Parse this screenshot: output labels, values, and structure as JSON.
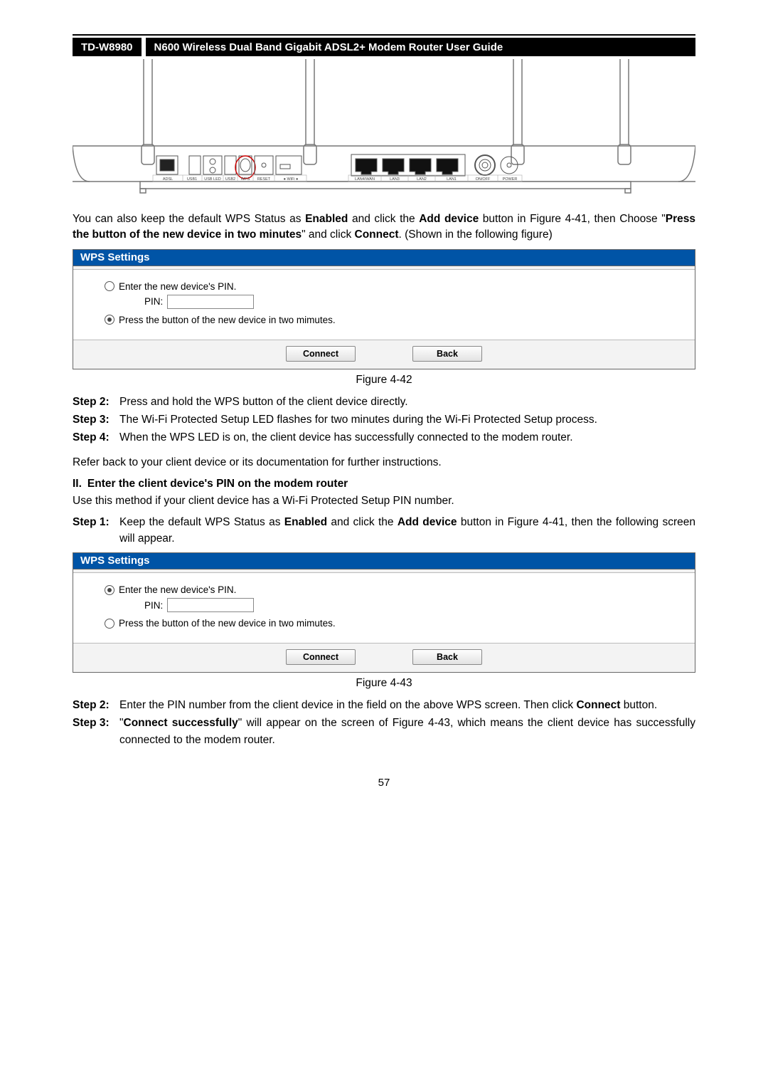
{
  "header": {
    "model": "TD-W8980",
    "title": "N600 Wireless Dual Band Gigabit ADSL2+ Modem Router User Guide"
  },
  "router_labels": {
    "adsl": "ADSL",
    "usb1": "USB1",
    "usbled": "USB LED",
    "usb2": "USB2",
    "wps": "WPS",
    "reset": "RESET",
    "wifi": "● WiFi ●",
    "lan4wan": "LAN4/WAN",
    "lan3": "LAN3",
    "lan2": "LAN2",
    "lan1": "LAN1",
    "onoff": "ON/OFF",
    "power": "POWER"
  },
  "para1_parts": {
    "t1": "You can also keep the default WPS Status as ",
    "b1": "Enabled",
    "t2": " and click the ",
    "b2": "Add device",
    "t3": " button in Figure 4-41, then Choose \"",
    "b3": "Press the button of the new device in two minutes",
    "t4": "\" and click ",
    "b4": "Connect",
    "t5": ". (Shown in the following figure)"
  },
  "wps1": {
    "title": "WPS Settings",
    "opt_pin": "Enter the new device's PIN.",
    "pin_label": "PIN:",
    "opt_button": "Press the button of the new device in two mimutes.",
    "connect": "Connect",
    "back": "Back",
    "selected": "button"
  },
  "fig42": "Figure 4-42",
  "steps_a": {
    "s2_label": "Step 2:",
    "s2": "Press and hold the WPS button of the client device directly.",
    "s3_label": "Step 3:",
    "s3": "The Wi-Fi Protected Setup LED flashes for two minutes during the Wi-Fi Protected Setup process.",
    "s4_label": "Step 4:",
    "s4": "When the WPS LED is on, the client device has successfully connected to the modem router."
  },
  "refer": "Refer back to your client device or its documentation for further instructions.",
  "section2": {
    "num": "II.",
    "title": "Enter the client device's PIN on the modem router"
  },
  "para2": "Use this method if your client device has a Wi-Fi Protected Setup PIN number.",
  "step1b": {
    "label": "Step 1:",
    "t1": "Keep the default WPS Status as ",
    "b1": "Enabled",
    "t2": " and click the ",
    "b2": "Add device",
    "t3": " button in Figure 4-41, then the following screen will appear."
  },
  "wps2": {
    "title": "WPS Settings",
    "opt_pin": "Enter the new device's PIN.",
    "pin_label": "PIN:",
    "opt_button": "Press the button of the new device in two mimutes.",
    "connect": "Connect",
    "back": "Back",
    "selected": "pin"
  },
  "fig43": "Figure 4-43",
  "steps_b": {
    "s2_label": "Step 2:",
    "s2_t1": "Enter the PIN number from the client device in the field on the above WPS screen. Then click ",
    "s2_b1": "Connect",
    "s2_t2": " button.",
    "s3_label": "Step 3:",
    "s3_t1": "\"",
    "s3_b1": "Connect successfully",
    "s3_t2": "\" will appear on the screen of Figure 4-43, which means the client device has successfully connected to the modem router."
  },
  "page_number": "57"
}
